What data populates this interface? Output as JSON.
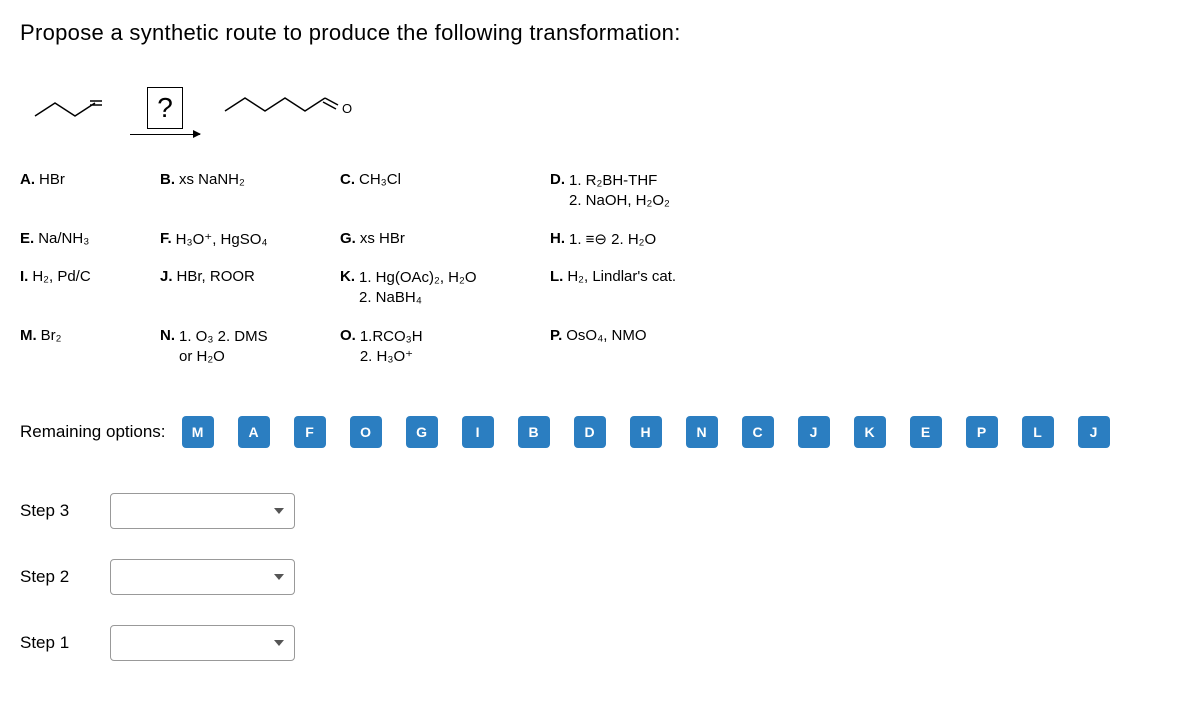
{
  "question": "Propose a synthetic route to produce the following transformation:",
  "qmark": "?",
  "options": {
    "A": {
      "label": "A.",
      "text": "HBr"
    },
    "B": {
      "label": "B.",
      "text": "xs NaNH₂"
    },
    "C": {
      "label": "C.",
      "text": "CH₃Cl"
    },
    "D": {
      "label": "D.",
      "line1": "1. R₂BH-THF",
      "line2": "2. NaOH, H₂O₂"
    },
    "E": {
      "label": "E.",
      "text": "Na/NH₃"
    },
    "F": {
      "label": "F.",
      "text": "H₃O⁺, HgSO₄"
    },
    "G": {
      "label": "G.",
      "text": "xs HBr"
    },
    "H": {
      "label": "H.",
      "text": "1. ≡⊖  2. H₂O"
    },
    "I": {
      "label": "I.",
      "text": "H₂, Pd/C"
    },
    "J": {
      "label": "J.",
      "text": "HBr, ROOR"
    },
    "K": {
      "label": "K.",
      "line1": "1. Hg(OAc)₂, H₂O",
      "line2": "2. NaBH₄"
    },
    "L": {
      "label": "L.",
      "text": "H₂, Lindlar's cat."
    },
    "M": {
      "label": "M.",
      "text": "Br₂"
    },
    "N": {
      "label": "N.",
      "line1": "1. O₃ 2. DMS",
      "line2": "or H₂O"
    },
    "O": {
      "label": "O.",
      "line1": "1.RCO₃H",
      "line2": "2. H₃O⁺"
    },
    "P": {
      "label": "P.",
      "text": "OsO₄, NMO"
    }
  },
  "remaining": {
    "label": "Remaining options:",
    "tags": [
      "M",
      "A",
      "F",
      "O",
      "G",
      "I",
      "B",
      "D",
      "H",
      "N",
      "C",
      "J",
      "K",
      "E",
      "P",
      "L",
      "J"
    ]
  },
  "steps": [
    {
      "label": "Step 3",
      "value": ""
    },
    {
      "label": "Step 2",
      "value": ""
    },
    {
      "label": "Step 1",
      "value": ""
    }
  ]
}
